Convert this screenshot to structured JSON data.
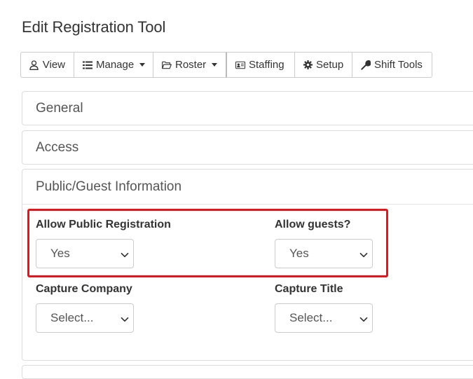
{
  "page": {
    "title": "Edit Registration Tool"
  },
  "toolbar": {
    "view": "View",
    "manage": "Manage",
    "roster": "Roster",
    "staffing": "Staffing",
    "setup": "Setup",
    "shift_tools": "Shift Tools"
  },
  "panels": {
    "general": "General",
    "access": "Access",
    "public": "Public/Guest Information"
  },
  "fields": {
    "allow_public_registration": {
      "label": "Allow Public Registration",
      "value": "Yes"
    },
    "allow_guests": {
      "label": "Allow guests?",
      "value": "Yes"
    },
    "capture_company": {
      "label": "Capture Company",
      "value": "Select..."
    },
    "capture_title": {
      "label": "Capture Title",
      "value": "Select..."
    }
  },
  "highlight_color": "#e8141b",
  "icons": [
    "user-icon",
    "list-icon",
    "folder-icon",
    "id-card-icon",
    "gear-icon",
    "wrench-icon",
    "chevron-down-icon"
  ]
}
